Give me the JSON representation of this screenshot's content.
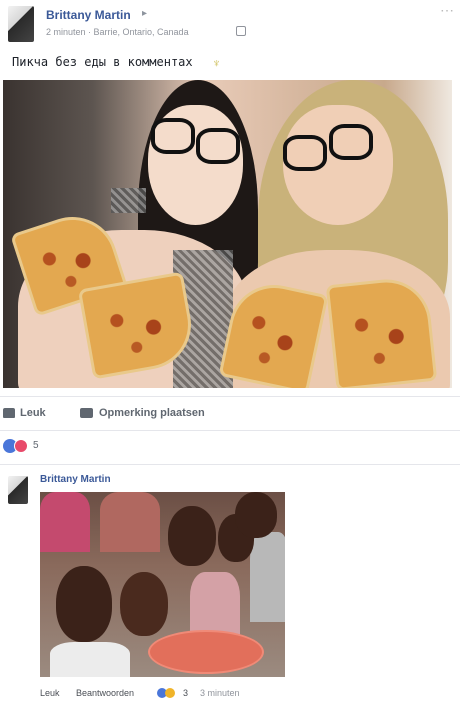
{
  "post": {
    "author": "Brittany Martin",
    "caret": "▸",
    "meta": "2 minuten · Barrie, Ontario, Canada",
    "text": "Пикча без еды в комментах",
    "options_glyph": "⋯",
    "sticker_glyph": "♆"
  },
  "actions": {
    "like_label": "Leuk",
    "comment_label": "Opmerking plaatsen"
  },
  "reactions": {
    "count": "5"
  },
  "comment": {
    "author": "Brittany Martin",
    "like_label": "Leuk",
    "reply_label": "Beantwoorden",
    "reaction_count": "3",
    "time": "3 minuten"
  },
  "colors": {
    "link_blue": "#3b5998",
    "reaction_like": "#4a76d9",
    "reaction_love": "#e84a6a"
  }
}
